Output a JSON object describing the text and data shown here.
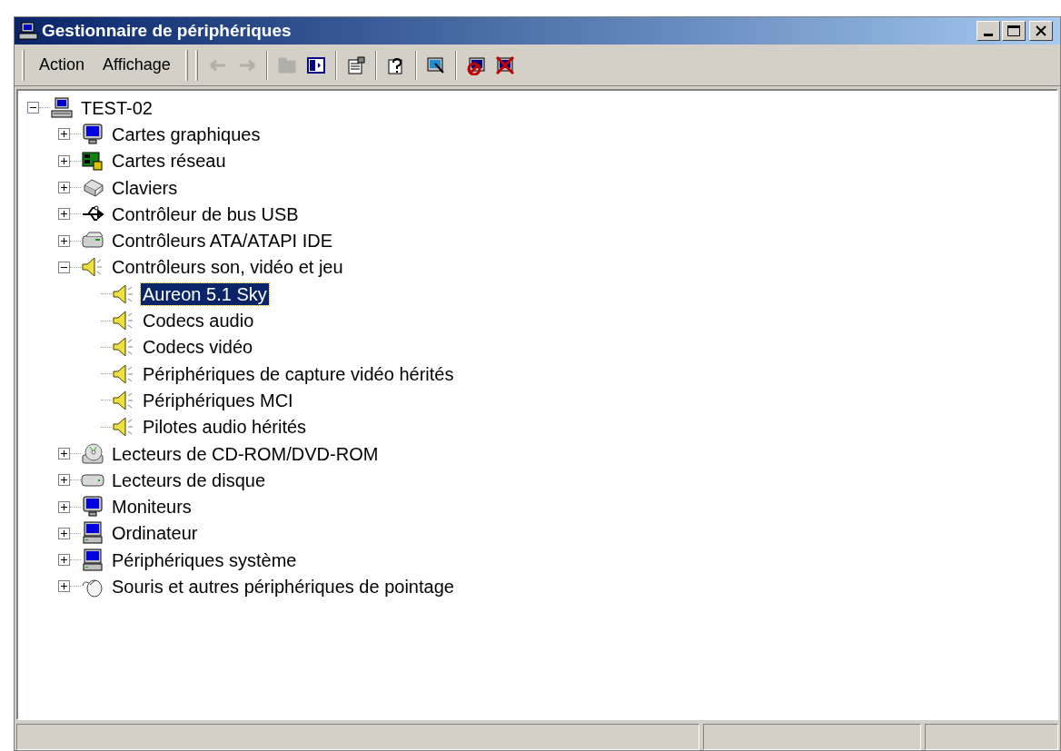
{
  "window": {
    "title": "Gestionnaire de périphériques"
  },
  "menu": [
    {
      "label": "Action"
    },
    {
      "label": "Affichage"
    }
  ],
  "toolbar": [
    {
      "kind": "back",
      "disabled": true
    },
    {
      "kind": "forward",
      "disabled": true
    },
    {
      "kind": "sep"
    },
    {
      "kind": "up",
      "disabled": true
    },
    {
      "kind": "tree",
      "disabled": false
    },
    {
      "kind": "sep"
    },
    {
      "kind": "properties",
      "disabled": false
    },
    {
      "kind": "sep"
    },
    {
      "kind": "help",
      "disabled": false
    },
    {
      "kind": "sep"
    },
    {
      "kind": "scan",
      "disabled": false
    },
    {
      "kind": "sep"
    },
    {
      "kind": "disable",
      "disabled": false
    },
    {
      "kind": "uninstall",
      "disabled": false
    }
  ],
  "tree": [
    {
      "label": "TEST-02",
      "kind": "computer",
      "expanded": true,
      "selected": false,
      "children": [
        {
          "label": "Cartes graphiques",
          "kind": "monitor",
          "expanded": false,
          "selected": false
        },
        {
          "label": "Cartes réseau",
          "kind": "network",
          "expanded": false,
          "selected": false
        },
        {
          "label": "Claviers",
          "kind": "keyboard",
          "expanded": false,
          "selected": false
        },
        {
          "label": "Contrôleur de bus USB",
          "kind": "usb",
          "expanded": false,
          "selected": false
        },
        {
          "label": "Contrôleurs ATA/ATAPI IDE",
          "kind": "controller",
          "expanded": false,
          "selected": false
        },
        {
          "label": "Contrôleurs son, vidéo et jeu",
          "kind": "speaker",
          "expanded": true,
          "selected": false,
          "children": [
            {
              "label": "Aureon 5.1 Sky",
              "kind": "speaker",
              "selected": true
            },
            {
              "label": "Codecs audio",
              "kind": "speaker",
              "selected": false
            },
            {
              "label": "Codecs vidéo",
              "kind": "speaker",
              "selected": false
            },
            {
              "label": "Périphériques de capture vidéo hérités",
              "kind": "speaker",
              "selected": false
            },
            {
              "label": "Périphériques MCI",
              "kind": "speaker",
              "selected": false
            },
            {
              "label": "Pilotes audio hérités",
              "kind": "speaker",
              "selected": false
            }
          ]
        },
        {
          "label": "Lecteurs de CD-ROM/DVD-ROM",
          "kind": "cdrom",
          "expanded": false,
          "selected": false
        },
        {
          "label": "Lecteurs de disque",
          "kind": "disk",
          "expanded": false,
          "selected": false
        },
        {
          "label": "Moniteurs",
          "kind": "monitor",
          "expanded": false,
          "selected": false
        },
        {
          "label": "Ordinateur",
          "kind": "pc",
          "expanded": false,
          "selected": false
        },
        {
          "label": "Périphériques système",
          "kind": "pc",
          "expanded": false,
          "selected": false
        },
        {
          "label": "Souris et autres périphériques de pointage",
          "kind": "mouse",
          "expanded": false,
          "selected": false
        }
      ]
    }
  ]
}
